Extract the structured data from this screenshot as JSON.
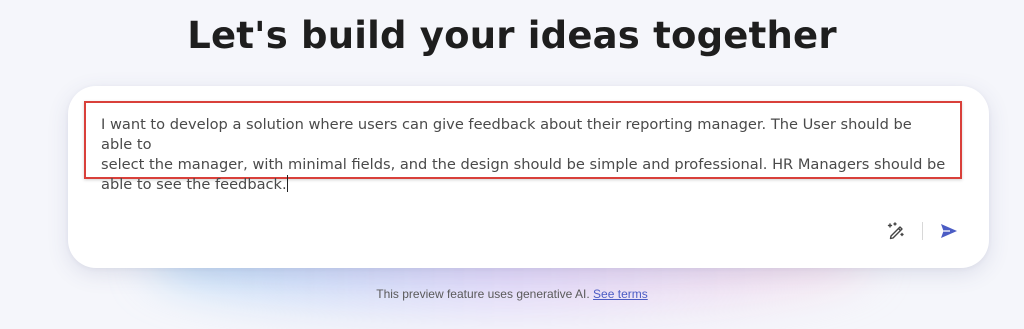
{
  "headline": "Let's build your ideas together",
  "prompt": {
    "text": "I want to develop a solution where users can give feedback about their reporting manager. The User should be able to\nselect the manager, with minimal fields, and the design should be simple and professional. HR Managers should be\nable to see the feedback."
  },
  "actions": {
    "enhance_icon": "magic-wand-pen-icon",
    "send_icon": "send-arrow-icon",
    "send_color": "#4b5cc4"
  },
  "footer": {
    "disclaimer": "This preview feature uses generative AI.",
    "link_label": "See terms"
  },
  "colors": {
    "highlight_border": "#d9403a",
    "accent": "#4b5cc4"
  }
}
